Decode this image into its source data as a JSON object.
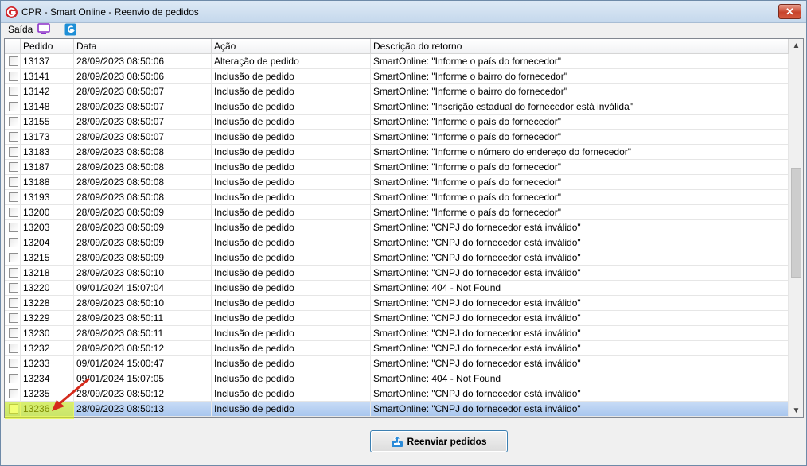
{
  "window": {
    "title": "CPR - Smart Online - Reenvio de pedidos",
    "close_glyph": "✕"
  },
  "menu": {
    "exit_label": "Saída"
  },
  "icons": {
    "app": "app-logo-icon",
    "monitor": "monitor-icon",
    "logo": "smart-logo-icon",
    "resend": "upload-icon"
  },
  "grid": {
    "columns": [
      "Pedido",
      "Data",
      "Ação",
      "Descrição do retorno"
    ],
    "rows": [
      {
        "pedido": "13137",
        "data": "28/09/2023 08:50:06",
        "acao": "Alteração de pedido",
        "descricao": "SmartOnline: \"Informe o país do fornecedor\""
      },
      {
        "pedido": "13141",
        "data": "28/09/2023 08:50:06",
        "acao": "Inclusão de pedido",
        "descricao": "SmartOnline: \"Informe o bairro do fornecedor\""
      },
      {
        "pedido": "13142",
        "data": "28/09/2023 08:50:07",
        "acao": "Inclusão de pedido",
        "descricao": "SmartOnline: \"Informe o bairro do fornecedor\""
      },
      {
        "pedido": "13148",
        "data": "28/09/2023 08:50:07",
        "acao": "Inclusão de pedido",
        "descricao": "SmartOnline: \"Inscrição estadual do fornecedor está inválida\""
      },
      {
        "pedido": "13155",
        "data": "28/09/2023 08:50:07",
        "acao": "Inclusão de pedido",
        "descricao": "SmartOnline: \"Informe o país do fornecedor\""
      },
      {
        "pedido": "13173",
        "data": "28/09/2023 08:50:07",
        "acao": "Inclusão de pedido",
        "descricao": "SmartOnline: \"Informe o país do fornecedor\""
      },
      {
        "pedido": "13183",
        "data": "28/09/2023 08:50:08",
        "acao": "Inclusão de pedido",
        "descricao": "SmartOnline: \"Informe o número do endereço do fornecedor\""
      },
      {
        "pedido": "13187",
        "data": "28/09/2023 08:50:08",
        "acao": "Inclusão de pedido",
        "descricao": "SmartOnline: \"Informe o país do fornecedor\""
      },
      {
        "pedido": "13188",
        "data": "28/09/2023 08:50:08",
        "acao": "Inclusão de pedido",
        "descricao": "SmartOnline: \"Informe o país do fornecedor\""
      },
      {
        "pedido": "13193",
        "data": "28/09/2023 08:50:08",
        "acao": "Inclusão de pedido",
        "descricao": "SmartOnline: \"Informe o país do fornecedor\""
      },
      {
        "pedido": "13200",
        "data": "28/09/2023 08:50:09",
        "acao": "Inclusão de pedido",
        "descricao": "SmartOnline: \"Informe o país do fornecedor\""
      },
      {
        "pedido": "13203",
        "data": "28/09/2023 08:50:09",
        "acao": "Inclusão de pedido",
        "descricao": "SmartOnline: \"CNPJ do fornecedor está inválido\""
      },
      {
        "pedido": "13204",
        "data": "28/09/2023 08:50:09",
        "acao": "Inclusão de pedido",
        "descricao": "SmartOnline: \"CNPJ do fornecedor está inválido\""
      },
      {
        "pedido": "13215",
        "data": "28/09/2023 08:50:09",
        "acao": "Inclusão de pedido",
        "descricao": "SmartOnline: \"CNPJ do fornecedor está inválido\""
      },
      {
        "pedido": "13218",
        "data": "28/09/2023 08:50:10",
        "acao": "Inclusão de pedido",
        "descricao": "SmartOnline: \"CNPJ do fornecedor está inválido\""
      },
      {
        "pedido": "13220",
        "data": "09/01/2024 15:07:04",
        "acao": "Inclusão de pedido",
        "descricao": "SmartOnline: 404 - Not Found"
      },
      {
        "pedido": "13228",
        "data": "28/09/2023 08:50:10",
        "acao": "Inclusão de pedido",
        "descricao": "SmartOnline: \"CNPJ do fornecedor está inválido\""
      },
      {
        "pedido": "13229",
        "data": "28/09/2023 08:50:11",
        "acao": "Inclusão de pedido",
        "descricao": "SmartOnline: \"CNPJ do fornecedor está inválido\""
      },
      {
        "pedido": "13230",
        "data": "28/09/2023 08:50:11",
        "acao": "Inclusão de pedido",
        "descricao": "SmartOnline: \"CNPJ do fornecedor está inválido\""
      },
      {
        "pedido": "13232",
        "data": "28/09/2023 08:50:12",
        "acao": "Inclusão de pedido",
        "descricao": "SmartOnline: \"CNPJ do fornecedor está inválido\""
      },
      {
        "pedido": "13233",
        "data": "09/01/2024 15:00:47",
        "acao": "Inclusão de pedido",
        "descricao": "SmartOnline: \"CNPJ do fornecedor está inválido\""
      },
      {
        "pedido": "13234",
        "data": "09/01/2024 15:07:05",
        "acao": "Inclusão de pedido",
        "descricao": "SmartOnline: 404 - Not Found"
      },
      {
        "pedido": "13235",
        "data": "28/09/2023 08:50:12",
        "acao": "Inclusão de pedido",
        "descricao": "SmartOnline: \"CNPJ do fornecedor está inválido\""
      },
      {
        "pedido": "13236",
        "data": "28/09/2023 08:50:13",
        "acao": "Inclusão de pedido",
        "descricao": "SmartOnline: \"CNPJ do fornecedor está inválido\"",
        "selected": true
      }
    ]
  },
  "footer": {
    "resend_label": "Reenviar pedidos"
  },
  "colors": {
    "selection": "#a8c6ee",
    "highlight": "#e6ff00",
    "arrow": "#d42a1c",
    "button_border": "#3c7fb1"
  }
}
